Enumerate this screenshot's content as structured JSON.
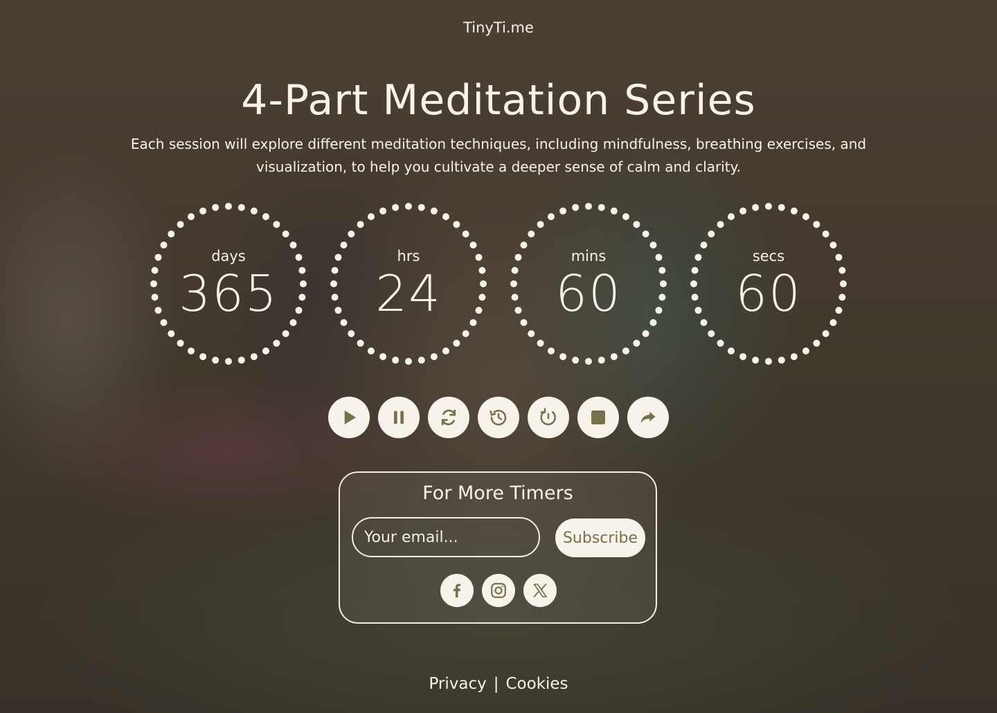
{
  "brand": "TinyTi.me",
  "title": "4-Part Meditation Series",
  "description": "Each session will explore different meditation techniques, including mindfulness, breathing exercises, and visualization, to help you cultivate a deeper sense of calm and clarity.",
  "countdown": [
    {
      "label": "days",
      "value": "365"
    },
    {
      "label": "hrs",
      "value": "24"
    },
    {
      "label": "mins",
      "value": "60"
    },
    {
      "label": "secs",
      "value": "60"
    }
  ],
  "controls": [
    {
      "icon": "play-icon"
    },
    {
      "icon": "pause-icon"
    },
    {
      "icon": "refresh-icon"
    },
    {
      "icon": "history-icon"
    },
    {
      "icon": "timer-reset-icon"
    },
    {
      "icon": "stop-icon"
    },
    {
      "icon": "share-icon"
    }
  ],
  "subscribe": {
    "title": "For More Timers",
    "email_placeholder": "Your email...",
    "button_label": "Subscribe"
  },
  "socials": [
    {
      "icon": "facebook-icon"
    },
    {
      "icon": "instagram-icon"
    },
    {
      "icon": "x-icon"
    }
  ],
  "footer": {
    "privacy": "Privacy",
    "separator": "|",
    "cookies": "Cookies"
  },
  "colors": {
    "text": "#f7f3ea",
    "accent": "#75714a",
    "button_bg": "#f7f3ea"
  }
}
